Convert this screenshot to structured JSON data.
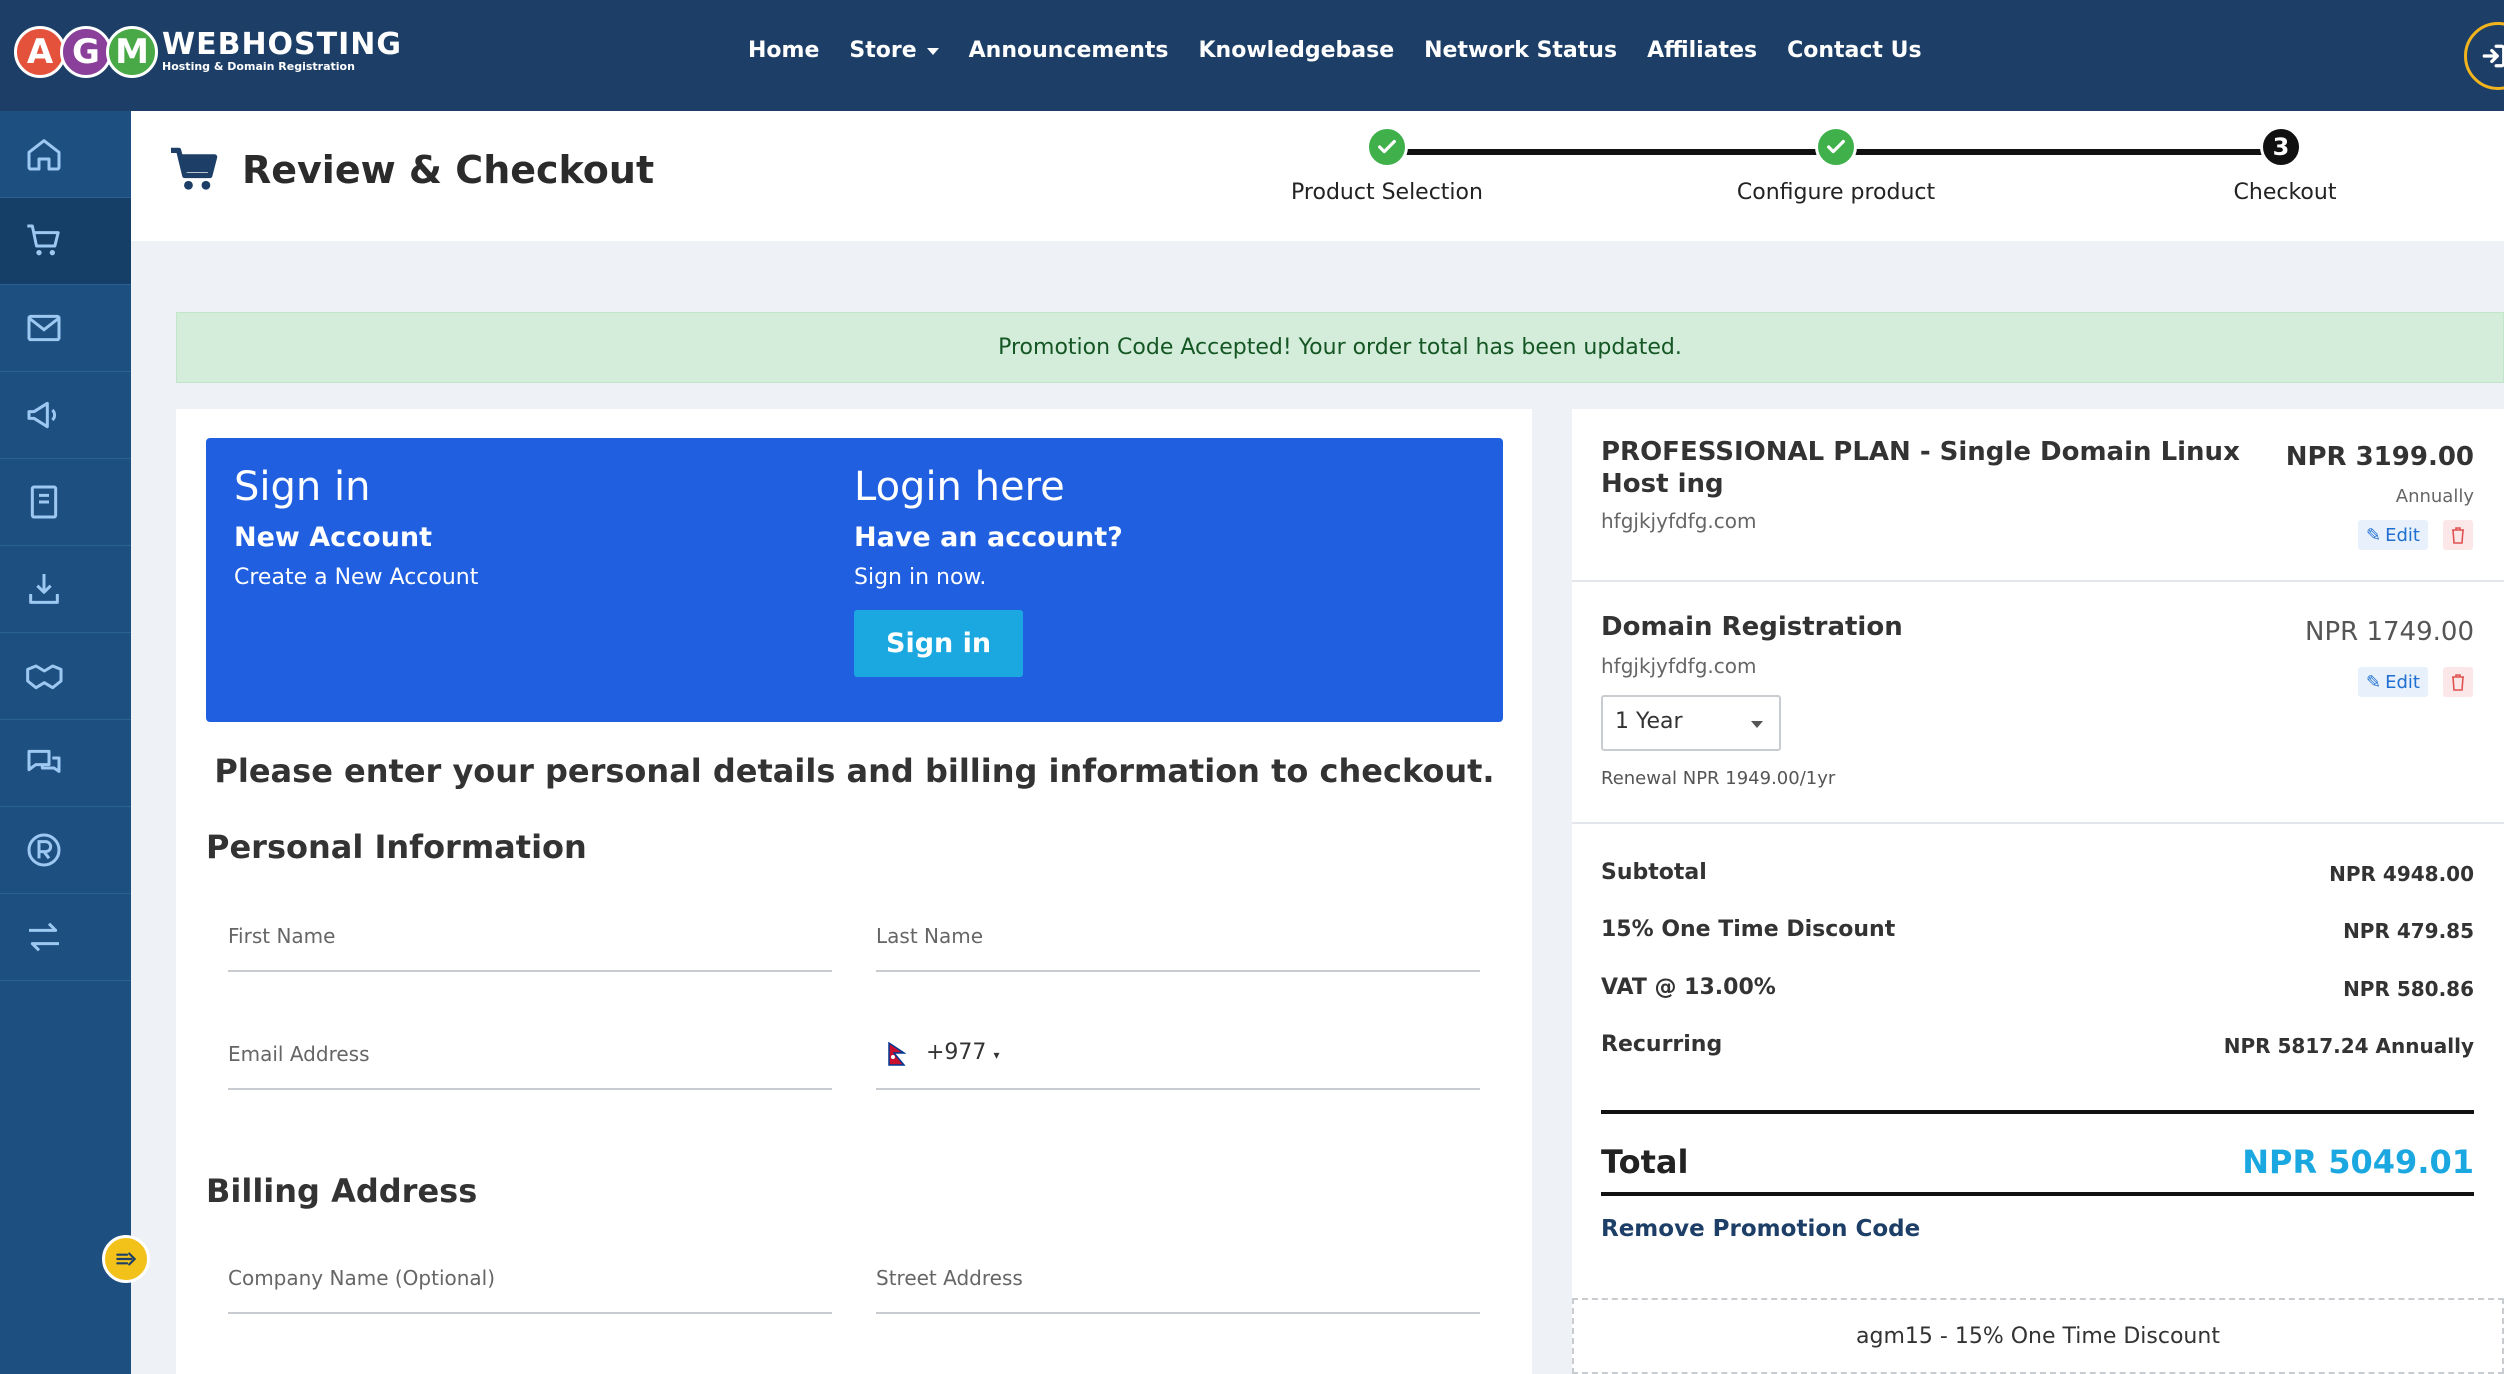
{
  "brand": {
    "logo_letters": [
      "A",
      "G",
      "M"
    ],
    "name": "WEBHOSTING",
    "tagline": "Hosting & Domain Registration",
    "colors": {
      "nav_bg": "#1d3f67",
      "sidebar_bg": "#1d4f80",
      "accent": "#1f5fe0",
      "total": "#1ba8e0",
      "success": "#3fb04a"
    }
  },
  "nav": {
    "items": [
      "Home",
      "Store",
      "Announcements",
      "Knowledgebase",
      "Network Status",
      "Affiliates",
      "Contact Us"
    ],
    "login_icon": "sign-in-icon"
  },
  "sidebar": {
    "items": [
      {
        "icon": "home-icon"
      },
      {
        "icon": "cart-icon"
      },
      {
        "icon": "envelope-icon"
      },
      {
        "icon": "megaphone-icon"
      },
      {
        "icon": "book-icon"
      },
      {
        "icon": "download-icon"
      },
      {
        "icon": "handshake-icon"
      },
      {
        "icon": "chat-icon"
      },
      {
        "icon": "registered-icon"
      },
      {
        "icon": "transfer-icon"
      }
    ]
  },
  "header": {
    "title": "Review & Checkout",
    "steps": [
      {
        "label": "Product Selection",
        "state": "done"
      },
      {
        "label": "Configure product",
        "state": "done"
      },
      {
        "label": "Checkout",
        "state": "current",
        "number": "3"
      }
    ]
  },
  "alert": {
    "text": "Promotion Code Accepted! Your order total has been updated."
  },
  "signin": {
    "left_title": "Sign in",
    "left_sub": "New Account",
    "left_text": "Create a New Account",
    "right_title": "Login here",
    "right_sub": "Have an account?",
    "right_text": "Sign in now.",
    "button": "Sign in"
  },
  "instructions": "Please enter your personal details and billing information to checkout.",
  "personal": {
    "heading": "Personal Information",
    "first_name": "First Name",
    "last_name": "Last Name",
    "email": "Email Address",
    "dial_code": "+977"
  },
  "billing": {
    "heading": "Billing Address",
    "company": "Company Name (Optional)",
    "street": "Street Address"
  },
  "cart": {
    "items": [
      {
        "name": "PROFESSIONAL PLAN - Single Domain Linux Host ing",
        "domain": "hfgjkjyfdfg.com",
        "price": "NPR 3199.00",
        "cycle": "Annually",
        "edit": "Edit"
      },
      {
        "name": "Domain Registration",
        "domain": "hfgjkjyfdfg.com",
        "price": "NPR 1749.00",
        "edit": "Edit",
        "period": "1 Year",
        "renewal": "Renewal NPR 1949.00/1yr"
      }
    ],
    "totals": [
      {
        "label": "Subtotal",
        "value": "NPR 4948.00"
      },
      {
        "label": "15% One Time Discount",
        "value": "NPR 479.85"
      },
      {
        "label": "VAT @ 13.00%",
        "value": "NPR 580.86"
      },
      {
        "label": "Recurring",
        "value": "NPR 5817.24 Annually"
      }
    ],
    "total_label": "Total",
    "total_value": "NPR 5049.01",
    "remove_promo": "Remove Promotion Code",
    "promo_applied": "agm15 - 15% One Time Discount"
  }
}
